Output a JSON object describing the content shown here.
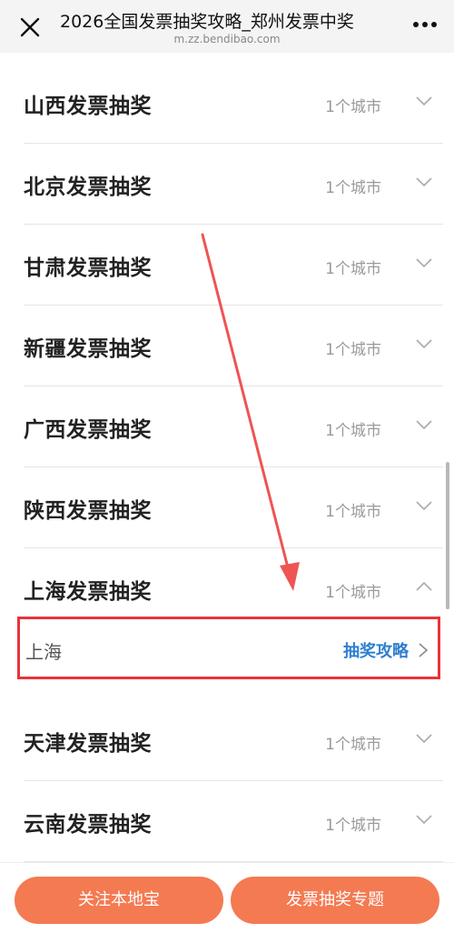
{
  "header": {
    "title": "2026全国发票抽奖攻略_郑州发票中奖",
    "url": "m.zz.bendibao.com"
  },
  "rows": [
    {
      "label": "山西发票抽奖",
      "count": "1个城市"
    },
    {
      "label": "北京发票抽奖",
      "count": "1个城市"
    },
    {
      "label": "甘肃发票抽奖",
      "count": "1个城市"
    },
    {
      "label": "新疆发票抽奖",
      "count": "1个城市"
    },
    {
      "label": "广西发票抽奖",
      "count": "1个城市"
    },
    {
      "label": "陕西发票抽奖",
      "count": "1个城市"
    },
    {
      "label": "上海发票抽奖",
      "count": "1个城市"
    },
    {
      "label": "天津发票抽奖",
      "count": "1个城市"
    },
    {
      "label": "云南发票抽奖",
      "count": "1个城市"
    }
  ],
  "expanded": {
    "city": "上海",
    "link": "抽奖攻略"
  },
  "bottom": {
    "follow": "关注本地宝",
    "topic": "发票抽奖专题"
  },
  "colors": {
    "accent": "#f47a52",
    "link": "#2f7fd0",
    "highlight": "#e8333a"
  }
}
